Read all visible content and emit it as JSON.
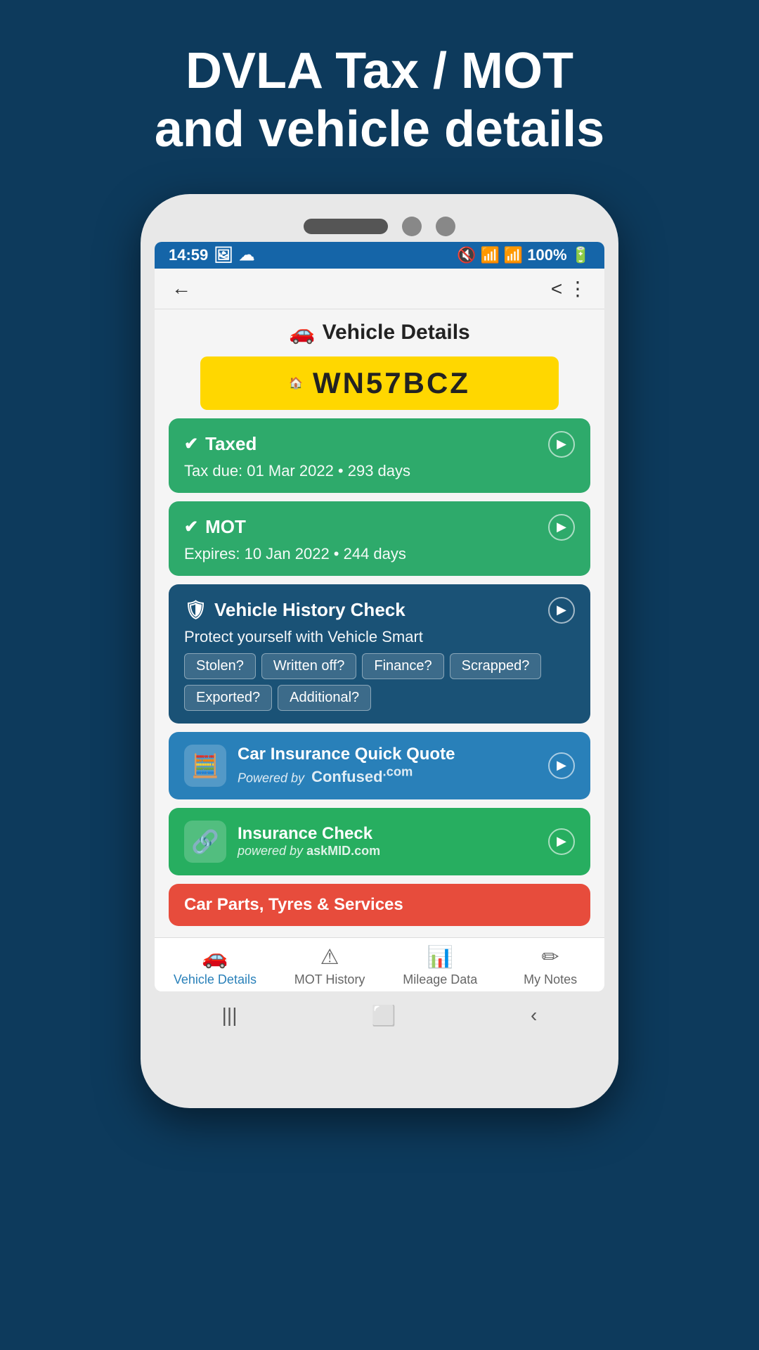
{
  "hero": {
    "title_line1": "DVLA Tax / MOT",
    "title_line2": "and vehicle details"
  },
  "status_bar": {
    "time": "14:59",
    "battery": "100%"
  },
  "page_title": "Vehicle Details",
  "license_plate": "WN57BCZ",
  "taxed_card": {
    "title": "Taxed",
    "subtitle": "Tax due: 01 Mar 2022 • 293 days"
  },
  "mot_card": {
    "title": "MOT",
    "subtitle": "Expires: 10 Jan 2022 • 244 days"
  },
  "history_card": {
    "title": "Vehicle History Check",
    "subtitle": "Protect yourself with Vehicle Smart",
    "tags": [
      "Stolen?",
      "Written off?",
      "Finance?",
      "Scrapped?",
      "Exported?",
      "Additional?"
    ]
  },
  "insurance_quote_card": {
    "title": "Car Insurance Quick Quote",
    "powered_by": "Powered by",
    "brand": "Confused",
    "brand_suffix": ".com"
  },
  "insurance_check_card": {
    "title": "Insurance Check",
    "powered_by": "powered by",
    "brand": "askMID.com"
  },
  "parts_card": {
    "title": "Car Parts, Tyres & Services"
  },
  "tabs": [
    {
      "label": "Vehicle Details",
      "active": true
    },
    {
      "label": "MOT History",
      "active": false
    },
    {
      "label": "Mileage Data",
      "active": false
    },
    {
      "label": "My Notes",
      "active": false
    }
  ],
  "bottom_nav": [
    "|||",
    "□",
    "<"
  ]
}
